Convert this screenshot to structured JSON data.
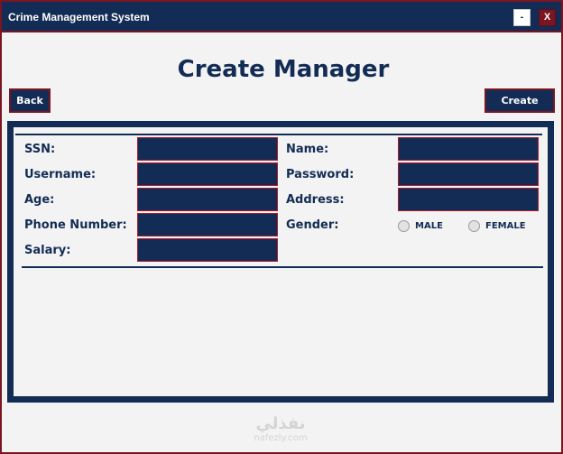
{
  "window": {
    "title": "Crime Management System",
    "minimize_label": "-",
    "close_label": "X"
  },
  "heading": "Create Manager",
  "buttons": {
    "back": "Back",
    "create": "Create"
  },
  "form": {
    "ssn": {
      "label": "SSN:",
      "value": ""
    },
    "username": {
      "label": "Username:",
      "value": ""
    },
    "age": {
      "label": "Age:",
      "value": ""
    },
    "phone": {
      "label": "Phone Number:",
      "value": ""
    },
    "salary": {
      "label": "Salary:",
      "value": ""
    },
    "name": {
      "label": "Name:",
      "value": ""
    },
    "password": {
      "label": "Password:",
      "value": ""
    },
    "address": {
      "label": "Address:",
      "value": ""
    },
    "gender": {
      "label": "Gender:",
      "options": [
        "MALE",
        "FEMALE"
      ],
      "selected": null
    }
  },
  "watermark": {
    "main": "نفذلي",
    "sub": "nafezly.com"
  },
  "colors": {
    "navy": "#132c55",
    "crimson": "#7a1522",
    "background": "#f3f3f3"
  }
}
